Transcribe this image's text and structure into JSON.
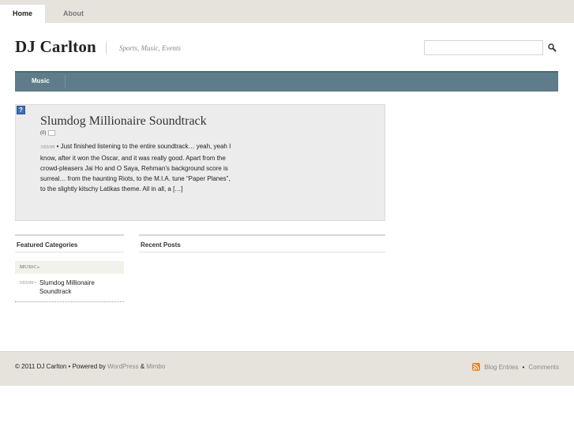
{
  "topnav": {
    "home": "Home",
    "about": "About"
  },
  "header": {
    "site_title": "DJ Carlton",
    "tagline": "Sports, Music, Events"
  },
  "search": {
    "value": ""
  },
  "nav": {
    "items": [
      {
        "label": "Music"
      }
    ]
  },
  "post": {
    "icon_glyph": "?",
    "title": "Slumdog Millionaire Soundtrack",
    "comments": "(0)",
    "date": "3/03/09",
    "excerpt": "Just finished listening to the entire soundtrack… yeah, yeah I know, after it won the Oscar, and it was really good. Apart from the crowd-pleasers Jai Ho and O Saya, Rehman’s background score is surreal… from the haunting Riots, to the M.I.A. tune “Paper Planes”, to the slightly kitschy Latikas theme. All in all, a […]"
  },
  "featured": {
    "heading": "Featured Categories",
    "category": "Music»",
    "posts": [
      {
        "date": "3/03/09",
        "title": "Slumdog Millionaire Soundtrack"
      }
    ]
  },
  "recent": {
    "heading": "Recent Posts"
  },
  "footer": {
    "copyright": "© 2011 DJ Carlton • Powered by",
    "wordpress": "WordPress",
    "amp": "&",
    "mimbo": "Mimbo",
    "blog_entries": "Blog Entries",
    "bullet": "•",
    "comments": "Comments"
  },
  "colors": {
    "nav_bg": "#5e7c89",
    "topbar_bg": "#e6e3dc",
    "rss": "#e8842a"
  },
  "icons": {
    "search": "magnifier-icon",
    "rss": "rss-icon",
    "post": "post-image-icon"
  }
}
